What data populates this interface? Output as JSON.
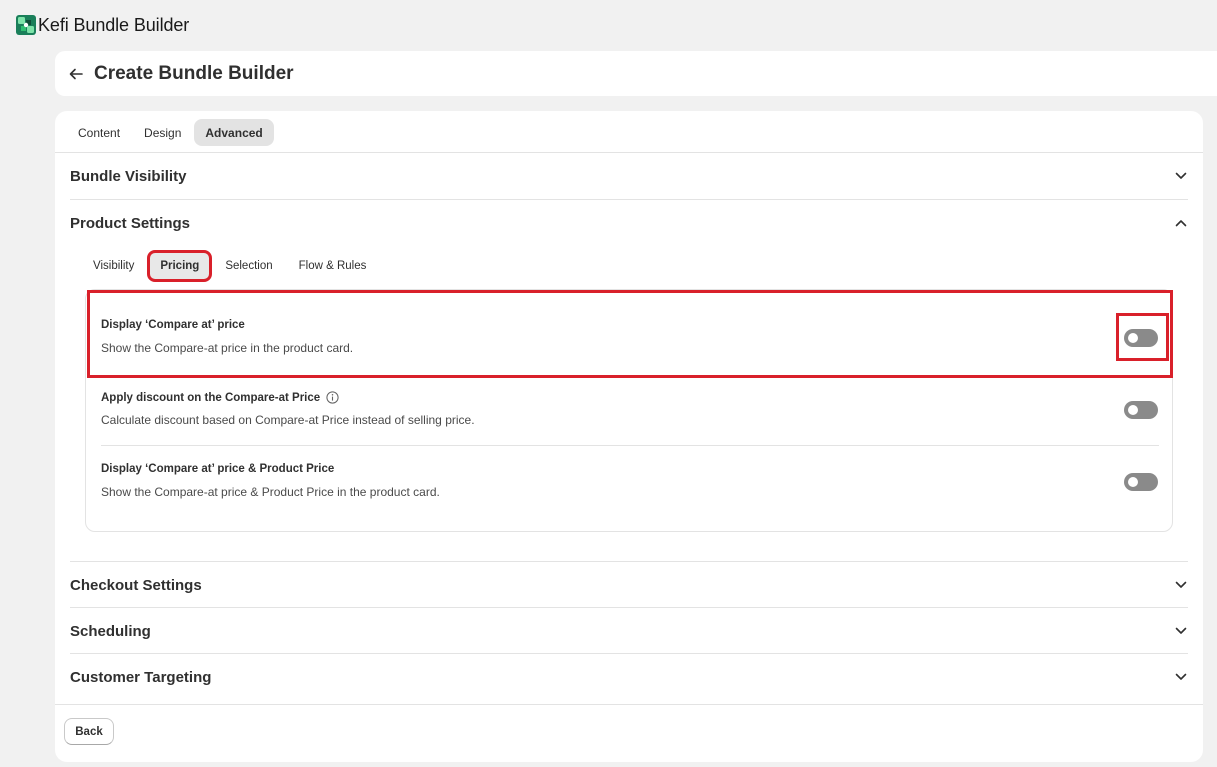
{
  "app": {
    "title": "Kefi Bundle Builder",
    "logo_icon": "kefi-logo-icon",
    "brand_colors": [
      "#1a7f5a",
      "#2fbf71"
    ]
  },
  "page": {
    "title": "Create Bundle Builder",
    "back_icon": "arrow-left-icon"
  },
  "top_tabs": [
    {
      "label": "Content",
      "active": false
    },
    {
      "label": "Design",
      "active": false
    },
    {
      "label": "Advanced",
      "active": true
    }
  ],
  "sections": {
    "bundle_visibility": {
      "title": "Bundle Visibility",
      "expanded": false
    },
    "product_settings": {
      "title": "Product Settings",
      "expanded": true
    },
    "checkout_settings": {
      "title": "Checkout Settings",
      "expanded": false
    },
    "scheduling": {
      "title": "Scheduling",
      "expanded": false
    },
    "customer_targeting": {
      "title": "Customer Targeting",
      "expanded": false
    }
  },
  "product_settings_tabs": [
    {
      "label": "Visibility",
      "active": false
    },
    {
      "label": "Pricing",
      "active": true
    },
    {
      "label": "Selection",
      "active": false
    },
    {
      "label": "Flow & Rules",
      "active": false
    }
  ],
  "pricing_options": [
    {
      "title": "Display ‘Compare at’ price",
      "description": "Show the Compare-at price in the product card.",
      "enabled": false,
      "has_info_icon": false
    },
    {
      "title": "Apply discount on the Compare-at Price",
      "description": "Calculate discount based on Compare-at Price instead of selling price.",
      "enabled": false,
      "has_info_icon": true
    },
    {
      "title": "Display ‘Compare at’ price & Product Price",
      "description": "Show the Compare-at price & Product Price in the product card.",
      "enabled": false,
      "has_info_icon": false
    }
  ],
  "footer": {
    "back_label": "Back"
  },
  "colors": {
    "highlight": "#d9202a",
    "toggle_off": "#8a8a8a",
    "page_bg": "#f1f1f1",
    "card_bg": "#ffffff"
  }
}
